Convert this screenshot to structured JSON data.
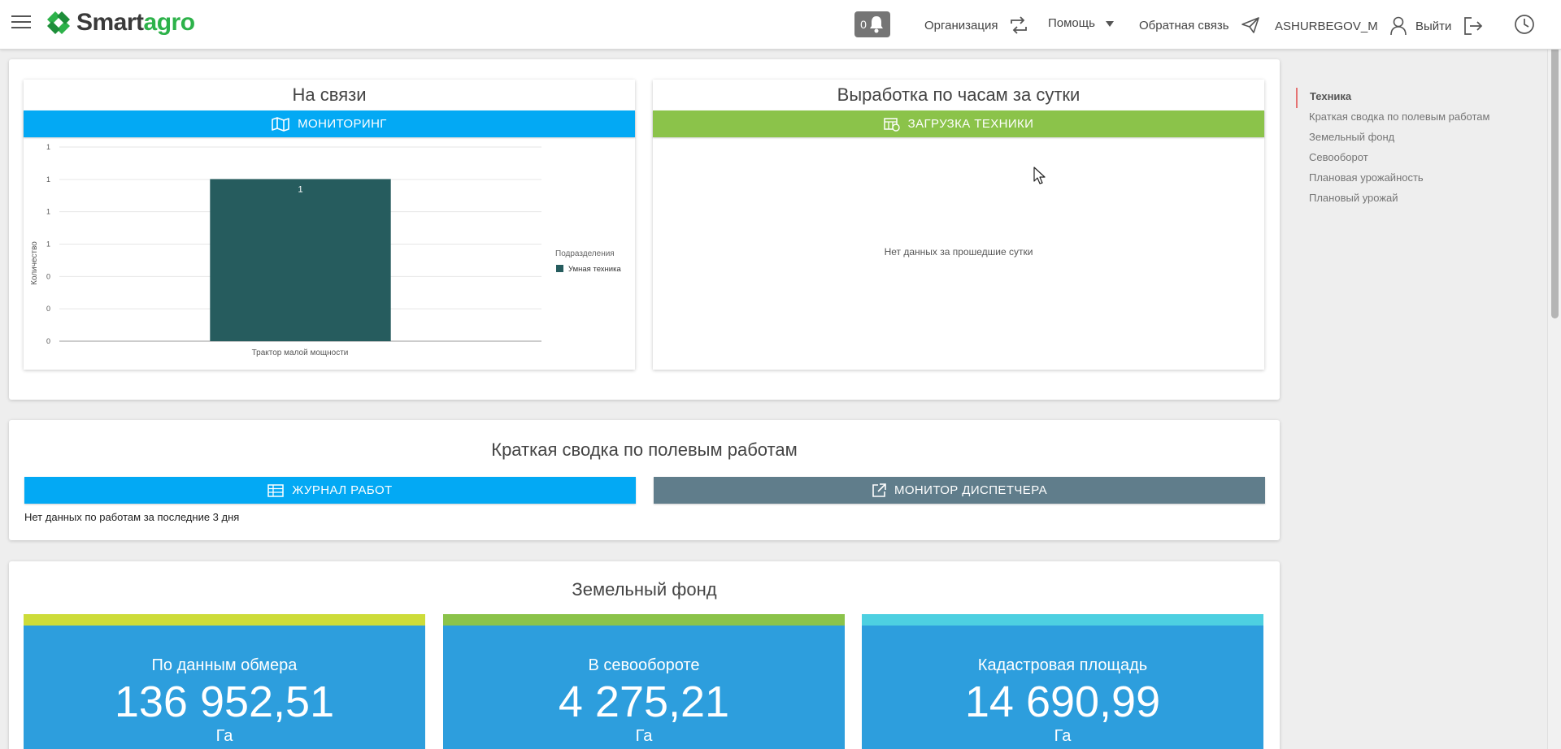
{
  "header": {
    "logo_part1": "Smart",
    "logo_part2": "agro",
    "notifications_count": "0",
    "organization_label": "Организация",
    "help_label": "Помощь",
    "feedback_label": "Обратная связь",
    "username": "ASHURBEGOV_M",
    "logout_label": "Выйти"
  },
  "online": {
    "title": "На связи",
    "button_label": "МОНИТОРИНГ"
  },
  "chart_data": {
    "type": "bar",
    "categories": [
      "Трактор малой мощности"
    ],
    "series": [
      {
        "name": "Умная техника",
        "values": [
          1
        ],
        "color": "#265c5e"
      }
    ],
    "ylabel": "Количество",
    "y_tick_labels": [
      "0",
      "0",
      "0",
      "1",
      "1",
      "1",
      "1"
    ],
    "data_labels": [
      "1"
    ],
    "legend_title": "Подразделения",
    "legend_position": "right"
  },
  "hourly": {
    "title": "Выработка по часам за сутки",
    "button_label": "ЗАГРУЗКА ТЕХНИКИ",
    "empty_text": "Нет данных за прошедшие сутки"
  },
  "summary": {
    "title": "Краткая сводка по полевым работам",
    "journal_label": "ЖУРНАЛ РАБОТ",
    "dispatcher_label": "МОНИТОР ДИСПЕТЧЕРА",
    "empty_text": "Нет данных по работам за последние 3 дня"
  },
  "land": {
    "title": "Земельный фонд",
    "cards": [
      {
        "label": "По данным обмера",
        "value": "136 952,51",
        "unit": "Га",
        "accent": "#cddc39"
      },
      {
        "label": "В севообороте",
        "value": "4 275,21",
        "unit": "Га",
        "accent": "#8bc34a"
      },
      {
        "label": "Кадастровая площадь",
        "value": "14 690,99",
        "unit": "Га",
        "accent": "#4dd0e1"
      }
    ]
  },
  "side_nav": {
    "items": [
      {
        "label": "Техника"
      },
      {
        "label": "Краткая сводка по полевым работам"
      },
      {
        "label": "Земельный фонд"
      },
      {
        "label": "Севооборот"
      },
      {
        "label": "Плановая урожайность"
      },
      {
        "label": "Плановый урожай"
      }
    ]
  },
  "colors": {
    "brand_green": "#2db24a",
    "accent_blue": "#03a9f4",
    "accent_green": "#8bc34a",
    "accent_grey": "#607d8b",
    "stat_blue": "#2d9edd"
  }
}
